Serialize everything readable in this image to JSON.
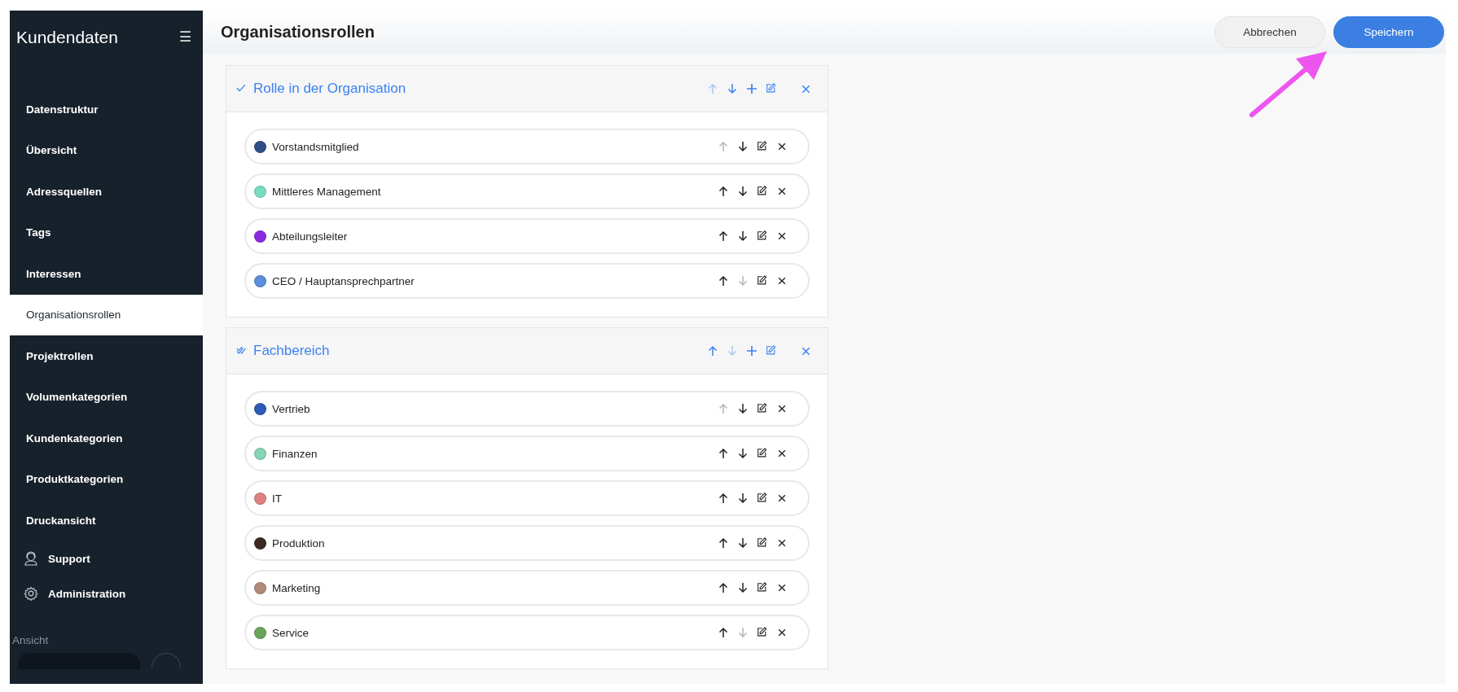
{
  "sidebar": {
    "title": "Kundendaten",
    "menu_icon": "☰",
    "items": [
      {
        "label": "Datenstruktur",
        "selected": false
      },
      {
        "label": "Übersicht",
        "selected": false
      },
      {
        "label": "Adressquellen",
        "selected": false
      },
      {
        "label": "Tags",
        "selected": false
      },
      {
        "label": "Interessen",
        "selected": false
      },
      {
        "label": "Organisationsrollen",
        "selected": true
      },
      {
        "label": "Projektrollen",
        "selected": false
      },
      {
        "label": "Volumenkategorien",
        "selected": false
      },
      {
        "label": "Kundenkategorien",
        "selected": false
      },
      {
        "label": "Produktkategorien",
        "selected": false
      },
      {
        "label": "Druckansicht",
        "selected": false
      }
    ],
    "links": [
      {
        "label": "Support",
        "kind": "support"
      },
      {
        "label": "Administration",
        "kind": "settings"
      }
    ],
    "section_label": "Ansicht"
  },
  "header": {
    "title": "Organisationsrollen",
    "buttons": [
      {
        "label": "Abbrechen",
        "kind": "secondary"
      },
      {
        "label": "Speichern",
        "kind": "primary"
      }
    ]
  },
  "groups": [
    {
      "title": "Rolle in der Organisation",
      "kind": "check",
      "up_disabled": true,
      "down_disabled": false,
      "items": [
        {
          "name": "Vorstandsmitglied",
          "color": "#2f4f86",
          "up_disabled": true,
          "down_disabled": false
        },
        {
          "name": "Mittleres Management",
          "color": "#7adcc0",
          "up_disabled": false,
          "down_disabled": false
        },
        {
          "name": "Abteilungsleiter",
          "color": "#8a2be2",
          "up_disabled": false,
          "down_disabled": false
        },
        {
          "name": "CEO / Hauptansprechpartner",
          "color": "#5b8fd9",
          "up_disabled": false,
          "down_disabled": true
        }
      ]
    },
    {
      "title": "Fachbereich",
      "kind": "double-check",
      "up_disabled": false,
      "down_disabled": true,
      "items": [
        {
          "name": "Vertrieb",
          "color": "#2d5bb5",
          "up_disabled": true,
          "down_disabled": false
        },
        {
          "name": "Finanzen",
          "color": "#86d3b5",
          "up_disabled": false,
          "down_disabled": false
        },
        {
          "name": "IT",
          "color": "#e08080",
          "up_disabled": false,
          "down_disabled": false
        },
        {
          "name": "Produktion",
          "color": "#3c2a22",
          "up_disabled": false,
          "down_disabled": false
        },
        {
          "name": "Marketing",
          "color": "#b08a78",
          "up_disabled": false,
          "down_disabled": false
        },
        {
          "name": "Service",
          "color": "#6aa35a",
          "up_disabled": false,
          "down_disabled": true
        }
      ]
    }
  ]
}
